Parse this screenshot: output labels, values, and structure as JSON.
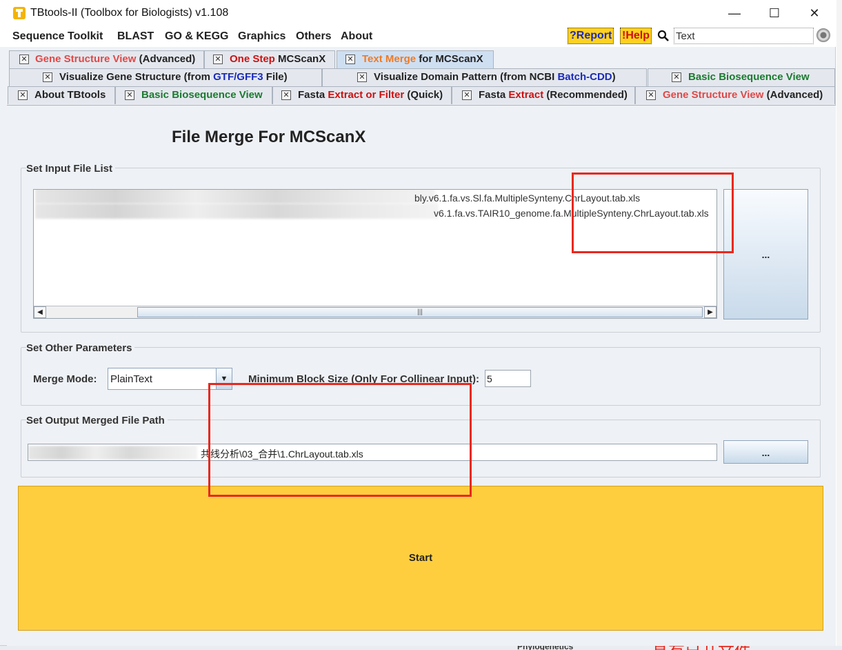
{
  "window": {
    "title": "TBtools-II (Toolbox for Biologists) v1.108",
    "minimize": "—",
    "maximize": "☐",
    "close": "✕"
  },
  "menubar": {
    "items": [
      "Sequence Toolkit",
      "BLAST",
      "GO & KEGG",
      "Graphics",
      "Others",
      "About"
    ],
    "report": "?Report",
    "help": "!Help",
    "search_value": "Text"
  },
  "tabs": {
    "row1": [
      {
        "parts": [
          "Gene Structure View",
          " (Advanced)"
        ]
      },
      {
        "parts": [
          "One Step ",
          "MCScanX"
        ]
      },
      {
        "parts": [
          "Text Merge",
          " for MCScanX"
        ]
      }
    ],
    "row2": [
      {
        "parts": [
          "Visualize Gene Structure (from ",
          "GTF/GFF3",
          " File)"
        ]
      },
      {
        "parts": [
          "Visualize Domain Pattern (from NCBI ",
          "Batch-CDD",
          ")"
        ]
      },
      {
        "parts": [
          "Basic Biosequence View"
        ]
      }
    ],
    "row3": [
      {
        "parts": [
          "About TBtools"
        ]
      },
      {
        "parts": [
          "Basic Biosequence View"
        ]
      },
      {
        "parts": [
          "Fasta ",
          "Extract or Filter",
          " (Quick)"
        ]
      },
      {
        "parts": [
          "Fasta ",
          "Extract",
          " (Recommended)"
        ]
      },
      {
        "parts": [
          "Gene Structure View",
          " (Advanced)"
        ]
      }
    ],
    "close_glyph": "✕"
  },
  "main": {
    "page_title": "File Merge For MCScanX",
    "input_group": {
      "title": "Set Input File List",
      "files": [
        "bly.v6.1.fa.vs.Sl.fa.MultipleSynteny.ChrLayout.tab.xls",
        "v6.1.fa.vs.TAIR10_genome.fa.MultipleSynteny.ChrLayout.tab.xls"
      ],
      "browse_label": "...",
      "scroll_left": "◀",
      "scroll_right": "▶",
      "scroll_grip": "|||"
    },
    "params_group": {
      "title": "Set Other Parameters",
      "merge_mode_label": "Merge Mode:",
      "merge_mode_value": "PlainText",
      "combo_arrow": "▼",
      "min_block_label": "Minimum Block Size (Only For Collinear Input):",
      "min_block_value": "5"
    },
    "output_group": {
      "title": "Set Output Merged File Path",
      "path_value": "共线分析\\03_合并\\1.ChrLayout.tab.xls",
      "browse_label": "..."
    },
    "start_label": "Start"
  },
  "background": {
    "snippet_phylo": "Phylogenetics",
    "snippet_red": "具有已开文件"
  },
  "colors": {
    "accent_yellow": "#ffce3f",
    "annotation_red": "#e8281e",
    "active_tab": "#cfdff2"
  }
}
